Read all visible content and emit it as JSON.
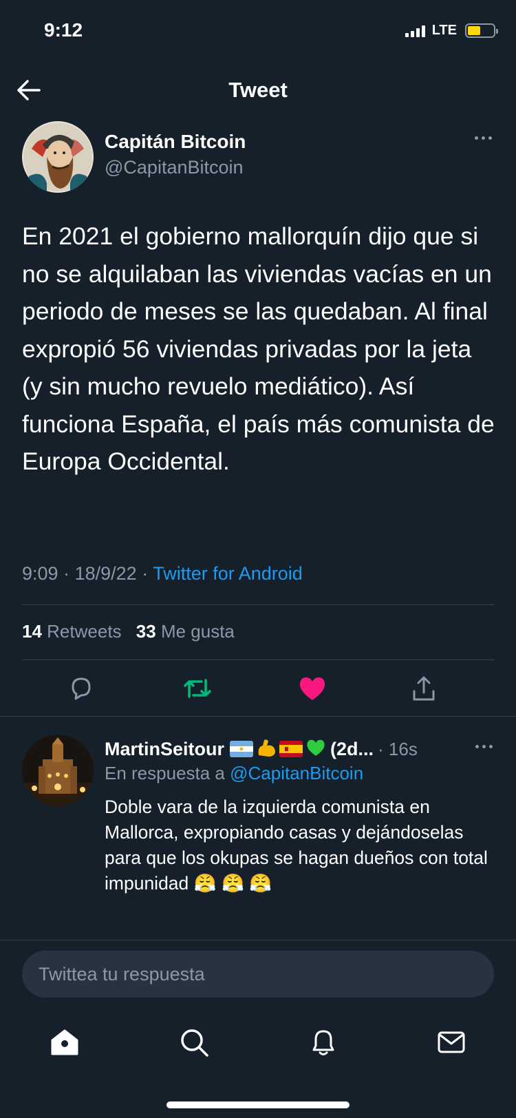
{
  "status_bar": {
    "time": "9:12",
    "network": "LTE"
  },
  "header": {
    "title": "Tweet"
  },
  "tweet": {
    "author_name": "Capitán Bitcoin",
    "author_handle": "@CapitanBitcoin",
    "text": "En 2021 el gobierno mallorquín dijo que si no se alquilaban las viviendas vacías en un periodo de meses se las quedaban. Al final expropió 56 viviendas privadas por la jeta (y sin mucho revuelo mediático). Así funciona España, el país más comunista de Europa Occidental.",
    "time": "9:09",
    "date": "18/9/22",
    "separator": "·",
    "source": "Twitter for Android",
    "retweets_count": "14",
    "retweets_label": "Retweets",
    "likes_count": "33",
    "likes_label": "Me gusta",
    "colors": {
      "retweet": "#00ba7c",
      "like": "#f91880",
      "link": "#1d9bf0"
    }
  },
  "reply": {
    "author_name": "MartinSeitour",
    "name_emojis": [
      "argentina-flag-icon",
      "flexed-biceps-icon",
      "spain-flag-icon",
      "green-heart-icon"
    ],
    "name_overflow": "(2d...",
    "time": "· 16s",
    "replying_to_label": "En respuesta a",
    "replying_to_handle": "@CapitanBitcoin",
    "text": "Doble vara de la izquierda comunista en Mallorca, expropiando casas y dejándoselas para que los okupas se hagan dueños con total impunidad 😤 😤 😤"
  },
  "compose": {
    "placeholder": "Twittea tu respuesta"
  },
  "tab_bar": {
    "items": [
      "home-icon",
      "search-icon",
      "notifications-icon",
      "messages-icon"
    ]
  }
}
